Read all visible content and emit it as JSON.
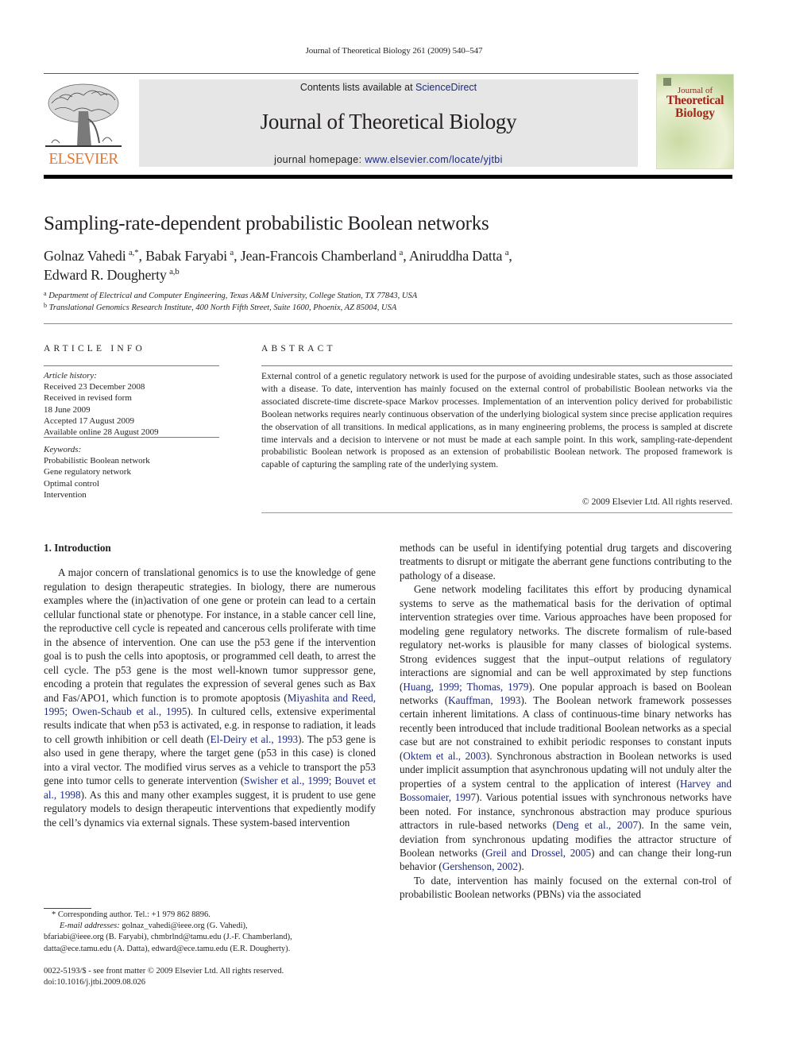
{
  "running_head": "Journal of Theoretical Biology 261 (2009) 540–547",
  "masthead": {
    "contents_prefix": "Contents lists available at ",
    "contents_link": "ScienceDirect",
    "journal_name": "Journal of Theoretical Biology",
    "homepage_prefix": "journal homepage: ",
    "homepage_link": "www.elsevier.com/locate/yjtbi",
    "publisher_logo_text": "ELSEVIER",
    "cover": {
      "line1": "Journal of",
      "line2": "Theoretical",
      "line3": "Biology"
    }
  },
  "article": {
    "title": "Sampling-rate-dependent probabilistic Boolean networks",
    "authors": [
      {
        "name": "Golnaz Vahedi",
        "sup": "a,*",
        "sep": ", "
      },
      {
        "name": "Babak Faryabi",
        "sup": "a",
        "sep": ", "
      },
      {
        "name": "Jean-Francois Chamberland",
        "sup": "a",
        "sep": ", "
      },
      {
        "name": "Aniruddha Datta",
        "sup": "a",
        "sep": ","
      },
      {
        "name": "Edward R. Dougherty",
        "sup": "a,b",
        "sep": ""
      }
    ],
    "affiliations": [
      {
        "label": "a",
        "text": "Department of Electrical and Computer Engineering, Texas A&M University, College Station, TX 77843, USA"
      },
      {
        "label": "b",
        "text": "Translational Genomics Research Institute, 400 North Fifth Street, Suite 1600, Phoenix, AZ 85004, USA"
      }
    ]
  },
  "article_info": {
    "heading": "ARTICLE INFO",
    "history_label": "Article history:",
    "history": [
      "Received 23 December 2008",
      "Received in revised form",
      "18 June 2009",
      "Accepted 17 August 2009",
      "Available online 28 August 2009"
    ],
    "keywords_label": "Keywords:",
    "keywords": [
      "Probabilistic Boolean network",
      "Gene regulatory network",
      "Optimal control",
      "Intervention"
    ]
  },
  "abstract": {
    "heading": "ABSTRACT",
    "text": "External control of a genetic regulatory network is used for the purpose of avoiding undesirable states, such as those associated with a disease. To date, intervention has mainly focused on the external control of probabilistic Boolean networks via the associated discrete-time discrete-space Markov processes. Implementation of an intervention policy derived for probabilistic Boolean networks requires nearly continuous observation of the underlying biological system since precise application requires the observation of all transitions. In medical applications, as in many engineering problems, the process is sampled at discrete time intervals and a decision to intervene or not must be made at each sample point. In this work, sampling-rate-dependent probabilistic Boolean network is proposed as an extension of probabilistic Boolean network. The proposed framework is capable of capturing the sampling rate of the underlying system.",
    "copyright": "© 2009 Elsevier Ltd. All rights reserved."
  },
  "body": {
    "section_heading": "1.  Introduction",
    "left_paragraphs": [
      [
        {
          "t": "A major concern of translational genomics is to use the knowledge of gene regulation to design therapeutic strategies. In biology, there are numerous examples where the (in)activation of one gene or protein can lead to a certain cellular functional state or phenotype. For instance, in a stable cancer cell line, the reproductive cell cycle is repeated and cancerous cells proliferate with time in the absence of intervention. One can use the p53 gene if the intervention goal is to push the cells into apoptosis, or programmed cell death, to arrest the cell cycle. The p53 gene is the most well-known tumor suppressor gene, encoding a protein that regulates the expression of several genes such as Bax and Fas/APO1, which function is to promote apoptosis ("
        },
        {
          "t": "Miyashita and Reed, 1995; Owen-Schaub et al., 1995",
          "link": true
        },
        {
          "t": "). In cultured cells, extensive experimental results indicate that when p53 is activated, e.g. in response to radiation, it leads to cell growth inhibition or cell death ("
        },
        {
          "t": "El-Deiry et al., 1993",
          "link": true
        },
        {
          "t": "). The p53 gene is also used in gene therapy, where the target gene (p53 in this case) is cloned into a viral vector. The modified virus serves as a vehicle to transport the p53 gene into tumor cells to generate intervention ("
        },
        {
          "t": "Swisher et al., 1999; Bouvet et al., 1998",
          "link": true
        },
        {
          "t": "). As this and many other examples suggest, it is prudent to use gene regulatory models to design therapeutic interventions that expediently modify the cell’s dynamics via external signals. These system-based intervention"
        }
      ]
    ],
    "right_paragraphs": [
      [
        {
          "t": "methods can be useful in identifying potential drug targets and discovering treatments to disrupt or mitigate the aberrant gene functions contributing to the pathology of a disease."
        }
      ],
      [
        {
          "t": "Gene network modeling facilitates this effort by producing dynamical systems to serve as the mathematical basis for the derivation of optimal intervention strategies over time. Various approaches have been proposed for modeling gene regulatory networks. The discrete formalism of rule-based regulatory net-works is plausible for many classes of biological systems. Strong evidences suggest that the input–output relations of regulatory interactions are signomial and can be well approximated by step functions ("
        },
        {
          "t": "Huang, 1999; Thomas, 1979",
          "link": true
        },
        {
          "t": "). One popular approach is based on Boolean networks ("
        },
        {
          "t": "Kauffman, 1993",
          "link": true
        },
        {
          "t": "). The Boolean network framework possesses certain inherent limitations. A class of continuous-time binary networks has recently been introduced that include traditional Boolean networks as a special case but are not constrained to exhibit periodic responses to constant inputs ("
        },
        {
          "t": "Oktem et al., 2003",
          "link": true
        },
        {
          "t": "). Synchronous abstraction in Boolean networks is used under implicit assumption that asynchronous updating will not unduly alter the properties of a system central to the application of interest ("
        },
        {
          "t": "Harvey and Bossomaier, 1997",
          "link": true
        },
        {
          "t": "). Various potential issues with synchronous networks have been noted. For instance, synchronous abstraction may produce spurious attractors in rule-based networks ("
        },
        {
          "t": "Deng et al., 2007",
          "link": true
        },
        {
          "t": "). In the same vein, deviation from synchronous updating modifies the attractor structure of Boolean networks ("
        },
        {
          "t": "Greil and Drossel, 2005",
          "link": true
        },
        {
          "t": ") and can change their long-run behavior ("
        },
        {
          "t": "Gershenson, 2002",
          "link": true
        },
        {
          "t": ")."
        }
      ],
      [
        {
          "t": "To date, intervention has mainly focused on the external con-trol of probabilistic Boolean networks (PBNs) via the associated"
        }
      ]
    ]
  },
  "footnotes": {
    "corresponding": "* Corresponding author. Tel.:  +1 979 862 8896.",
    "email_label": "E-mail addresses:",
    "email_line1": " golnaz_vahedi@ieee.org (G. Vahedi),",
    "email_line2": "bfariabi@ieee.org (B. Faryabi), chmbrlnd@tamu.edu (J.-F. Chamberland),",
    "email_line3": "datta@ece.tamu.edu (A. Datta), edward@ece.tamu.edu (E.R. Dougherty).",
    "front_matter": "0022-5193/$ - see front matter © 2009 Elsevier Ltd. All rights reserved.",
    "doi": "doi:10.1016/j.jtbi.2009.08.026"
  },
  "colors": {
    "link": "#1d2a80",
    "elsevier_orange": "#e8762d",
    "banner_gray": "#e6e6e6",
    "cover_title_red": "#a02618"
  }
}
